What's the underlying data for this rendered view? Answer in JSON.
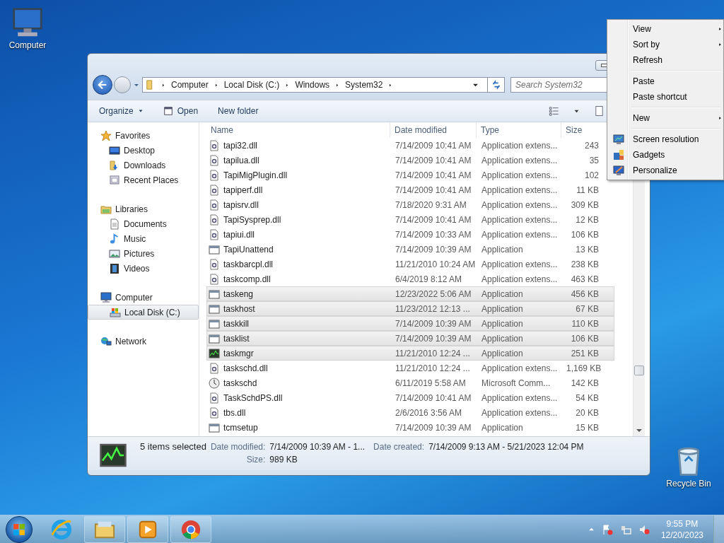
{
  "desktop_icons": [
    {
      "label": "Computer",
      "kind": "computer"
    },
    {
      "label": "Recycle Bin",
      "kind": "bin"
    }
  ],
  "window": {
    "address": [
      "Computer",
      "Local Disk (C:)",
      "Windows",
      "System32"
    ],
    "search": {
      "placeholder": "Search System32"
    },
    "toolbar": [
      {
        "label": "Organize",
        "kind": "dropdown"
      },
      {
        "label": "Open",
        "kind": "icon"
      },
      {
        "label": "New folder",
        "kind": "plain"
      }
    ],
    "sidebar": {
      "items": [
        {
          "label": "Favorites",
          "kind": "star",
          "selected": false,
          "children": [
            {
              "label": "Desktop",
              "kind": "desktop",
              "selected": false
            },
            {
              "label": "Downloads",
              "kind": "downloads",
              "selected": false
            },
            {
              "label": "Recent Places",
              "kind": "recent",
              "selected": false
            }
          ]
        },
        {
          "label": "Libraries",
          "kind": "libraries",
          "selected": false,
          "children": [
            {
              "label": "Documents",
              "kind": "documents",
              "selected": false
            },
            {
              "label": "Music",
              "kind": "music",
              "selected": false
            },
            {
              "label": "Pictures",
              "kind": "pictures",
              "selected": false
            },
            {
              "label": "Videos",
              "kind": "videos",
              "selected": false
            }
          ]
        },
        {
          "label": "Computer",
          "kind": "computer",
          "selected": false,
          "children": [
            {
              "label": "Local Disk (C:)",
              "kind": "disk",
              "selected": true
            }
          ]
        },
        {
          "label": "Network",
          "kind": "network",
          "selected": false
        }
      ]
    },
    "table": {
      "columns": [
        "Name",
        "Date modified",
        "Type",
        "Size"
      ],
      "rows": [
        {
          "name": "tapi32.dll",
          "kind": "dll",
          "date": "7/14/2009 10:41 AM",
          "type": "Application extens...",
          "size": "243",
          "selected": false
        },
        {
          "name": "tapilua.dll",
          "kind": "dll",
          "date": "7/14/2009 10:41 AM",
          "type": "Application extens...",
          "size": "35",
          "selected": false
        },
        {
          "name": "TapiMigPlugin.dll",
          "kind": "dll",
          "date": "7/14/2009 10:41 AM",
          "type": "Application extens...",
          "size": "102",
          "selected": false
        },
        {
          "name": "tapiperf.dll",
          "kind": "dll",
          "date": "7/14/2009 10:41 AM",
          "type": "Application extens...",
          "size": "11 KB",
          "selected": false
        },
        {
          "name": "tapisrv.dll",
          "kind": "dll",
          "date": "7/18/2020 9:31 AM",
          "type": "Application extens...",
          "size": "309 KB",
          "selected": false
        },
        {
          "name": "TapiSysprep.dll",
          "kind": "dll",
          "date": "7/14/2009 10:41 AM",
          "type": "Application extens...",
          "size": "12 KB",
          "selected": false
        },
        {
          "name": "tapiui.dll",
          "kind": "dll",
          "date": "7/14/2009 10:33 AM",
          "type": "Application extens...",
          "size": "106 KB",
          "selected": false
        },
        {
          "name": "TapiUnattend",
          "kind": "app",
          "date": "7/14/2009 10:39 AM",
          "type": "Application",
          "size": "13 KB",
          "selected": false
        },
        {
          "name": "taskbarcpl.dll",
          "kind": "dll",
          "date": "11/21/2010 10:24 AM",
          "type": "Application extens...",
          "size": "238 KB",
          "selected": false
        },
        {
          "name": "taskcomp.dll",
          "kind": "dll",
          "date": "6/4/2019 8:12 AM",
          "type": "Application extens...",
          "size": "463 KB",
          "selected": false
        },
        {
          "name": "taskeng",
          "kind": "app",
          "date": "12/23/2022 5:06 AM",
          "type": "Application",
          "size": "456 KB",
          "selected": true
        },
        {
          "name": "taskhost",
          "kind": "app",
          "date": "11/23/2012 12:13 ...",
          "type": "Application",
          "size": "67 KB",
          "selected": true
        },
        {
          "name": "taskkill",
          "kind": "app",
          "date": "7/14/2009 10:39 AM",
          "type": "Application",
          "size": "110 KB",
          "selected": true
        },
        {
          "name": "tasklist",
          "kind": "app",
          "date": "7/14/2009 10:39 AM",
          "type": "Application",
          "size": "106 KB",
          "selected": true
        },
        {
          "name": "taskmgr",
          "kind": "monitor",
          "date": "11/21/2010 12:24 ...",
          "type": "Application",
          "size": "251 KB",
          "selected": true
        },
        {
          "name": "taskschd.dll",
          "kind": "dll",
          "date": "11/21/2010 12:24 ...",
          "type": "Application extens...",
          "size": "1,169 KB",
          "selected": false
        },
        {
          "name": "taskschd",
          "kind": "clock",
          "date": "6/11/2019 5:58 AM",
          "type": "Microsoft Comm...",
          "size": "142 KB",
          "selected": false
        },
        {
          "name": "TaskSchdPS.dll",
          "kind": "dll",
          "date": "7/14/2009 10:41 AM",
          "type": "Application extens...",
          "size": "54 KB",
          "selected": false
        },
        {
          "name": "tbs.dll",
          "kind": "dll",
          "date": "2/6/2016 3:56 AM",
          "type": "Application extens...",
          "size": "20 KB",
          "selected": false
        },
        {
          "name": "tcmsetup",
          "kind": "app",
          "date": "7/14/2009 10:39 AM",
          "type": "Application",
          "size": "15 KB",
          "selected": false
        }
      ]
    },
    "details": {
      "summary": "5 items selected",
      "fields": [
        {
          "label": "Date modified:",
          "value": "7/14/2009 10:39 AM - 1..."
        },
        {
          "label": "Date created:",
          "value": "7/14/2009 9:13 AM - 5/21/2023 12:04 PM"
        },
        {
          "label": "Size:",
          "value": "989 KB"
        }
      ]
    }
  },
  "context_menu": {
    "groups": [
      [
        {
          "label": "View",
          "submenu": true,
          "kind": "plain"
        },
        {
          "label": "Sort by",
          "submenu": true,
          "kind": "plain"
        },
        {
          "label": "Refresh",
          "submenu": false,
          "kind": "plain"
        }
      ],
      [
        {
          "label": "Paste",
          "submenu": false,
          "kind": "plain"
        },
        {
          "label": "Paste shortcut",
          "submenu": false,
          "kind": "plain"
        }
      ],
      [
        {
          "label": "New",
          "submenu": true,
          "kind": "plain"
        }
      ],
      [
        {
          "label": "Screen resolution",
          "submenu": false,
          "kind": "screen"
        },
        {
          "label": "Gadgets",
          "submenu": false,
          "kind": "gadgets"
        },
        {
          "label": "Personalize",
          "submenu": false,
          "kind": "personalize"
        }
      ]
    ]
  },
  "taskbar": {
    "apps": [
      {
        "kind": "ie",
        "running": false
      },
      {
        "kind": "explorer",
        "running": true
      },
      {
        "kind": "media",
        "running": true
      },
      {
        "kind": "chrome",
        "running": true
      }
    ],
    "tray": [
      {
        "kind": "flag"
      },
      {
        "kind": "network"
      },
      {
        "kind": "volume"
      }
    ],
    "time": "9:55 PM",
    "date": "12/20/2023"
  }
}
